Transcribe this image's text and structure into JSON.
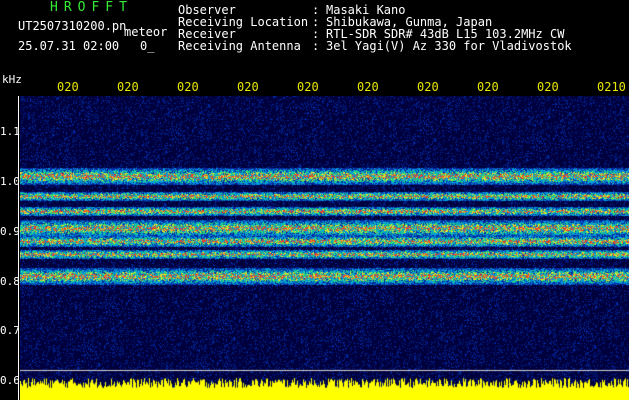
{
  "header": {
    "title": "HROFFT",
    "file_name": "UT2507310200.pn",
    "meteor_label": "meteor",
    "date_time": "25.07.31 02:00",
    "count": "0_",
    "info": [
      {
        "label": "Observer",
        "value": "Masaki Kano"
      },
      {
        "label": "Receiving Location",
        "value": "Shibukawa, Gunma, Japan"
      },
      {
        "label": "Receiver",
        "value": "RTL-SDR SDR# 43dB L15 103.2MHz CW"
      },
      {
        "label": "Receiving Antenna",
        "value": "3el Yagi(V) Az 330 for Vladivostok"
      }
    ]
  },
  "y_axis": {
    "unit": "kHz",
    "ticks": [
      "1.1",
      "1.0",
      "0.9",
      "0.8",
      "0.7",
      "0.6"
    ]
  },
  "time_labels": [
    "020",
    "020",
    "020",
    "020",
    "020",
    "020",
    "020",
    "020",
    "020",
    "0210"
  ],
  "colors": {
    "background": "#000000",
    "title": "#33ee33",
    "time_labels": "#e8e800",
    "baseline_signal": "#ffff00",
    "text": "#ffffff"
  }
}
